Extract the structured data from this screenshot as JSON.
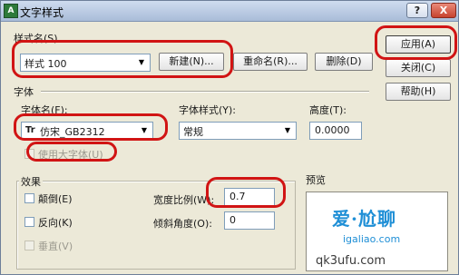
{
  "window": {
    "title": "文字样式",
    "app_icon_text": "A",
    "help_btn": "?",
    "close_btn": "X"
  },
  "style_name": {
    "label": "样式名(S)",
    "value": "样式 100",
    "new_btn": "新建(N)...",
    "rename_btn": "重命名(R)...",
    "delete_btn": "删除(D)"
  },
  "side_buttons": {
    "apply": "应用(A)",
    "close": "关闭(C)",
    "help": "帮助(H)"
  },
  "font": {
    "section_label": "字体",
    "name_label": "字体名(F):",
    "name_value": "仿宋_GB2312",
    "name_icon": "Tr",
    "style_label": "字体样式(Y):",
    "style_value": "常规",
    "height_label": "高度(T):",
    "height_value": "0.0000",
    "bigfont_label": "使用大字体(U)"
  },
  "effects": {
    "section_label": "效果",
    "upside_down": "颠倒(E)",
    "backwards": "反向(K)",
    "vertical": "垂直(V)",
    "width_factor_label": "宽度比例(W):",
    "width_factor_value": "0.7",
    "oblique_label": "倾斜角度(O):",
    "oblique_value": "0"
  },
  "preview": {
    "label": "预览",
    "watermark_main": "爱·尬聊",
    "watermark_url": "igaliao.com",
    "watermark_bottom": "qk3ufu.com"
  },
  "colors": {
    "highlight": "#d11414",
    "dialog_bg": "#ece9d8"
  }
}
